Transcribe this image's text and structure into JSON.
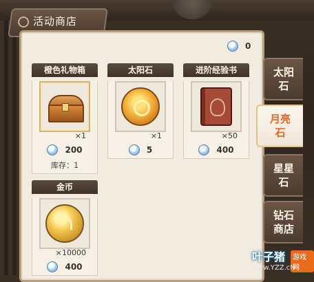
{
  "header": {
    "title": "活动商店"
  },
  "currency": {
    "value": "0",
    "icon": "moonstone-gem-icon"
  },
  "items": [
    {
      "name": "橙色礼物箱",
      "qty": "×1",
      "price": "200",
      "stock": "库存：1",
      "icon": "treasure-chest-icon"
    },
    {
      "name": "太阳石",
      "qty": "×1",
      "price": "5",
      "icon": "sun-stone-icon"
    },
    {
      "name": "进阶经验书",
      "qty": "×50",
      "price": "400",
      "icon": "exp-book-icon"
    },
    {
      "name": "金币",
      "qty": "×10000",
      "price": "400",
      "icon": "gold-coin-icon"
    }
  ],
  "tabs": [
    {
      "label": "太阳\n石",
      "active": false
    },
    {
      "label": "月亮\n石",
      "active": true
    },
    {
      "label": "星星\n石",
      "active": false
    },
    {
      "label": "钻石\n商店",
      "active": false
    }
  ],
  "watermark": {
    "brand": "叶子猪",
    "tag": "游戏网",
    "url": "www.YZZ.cN"
  }
}
